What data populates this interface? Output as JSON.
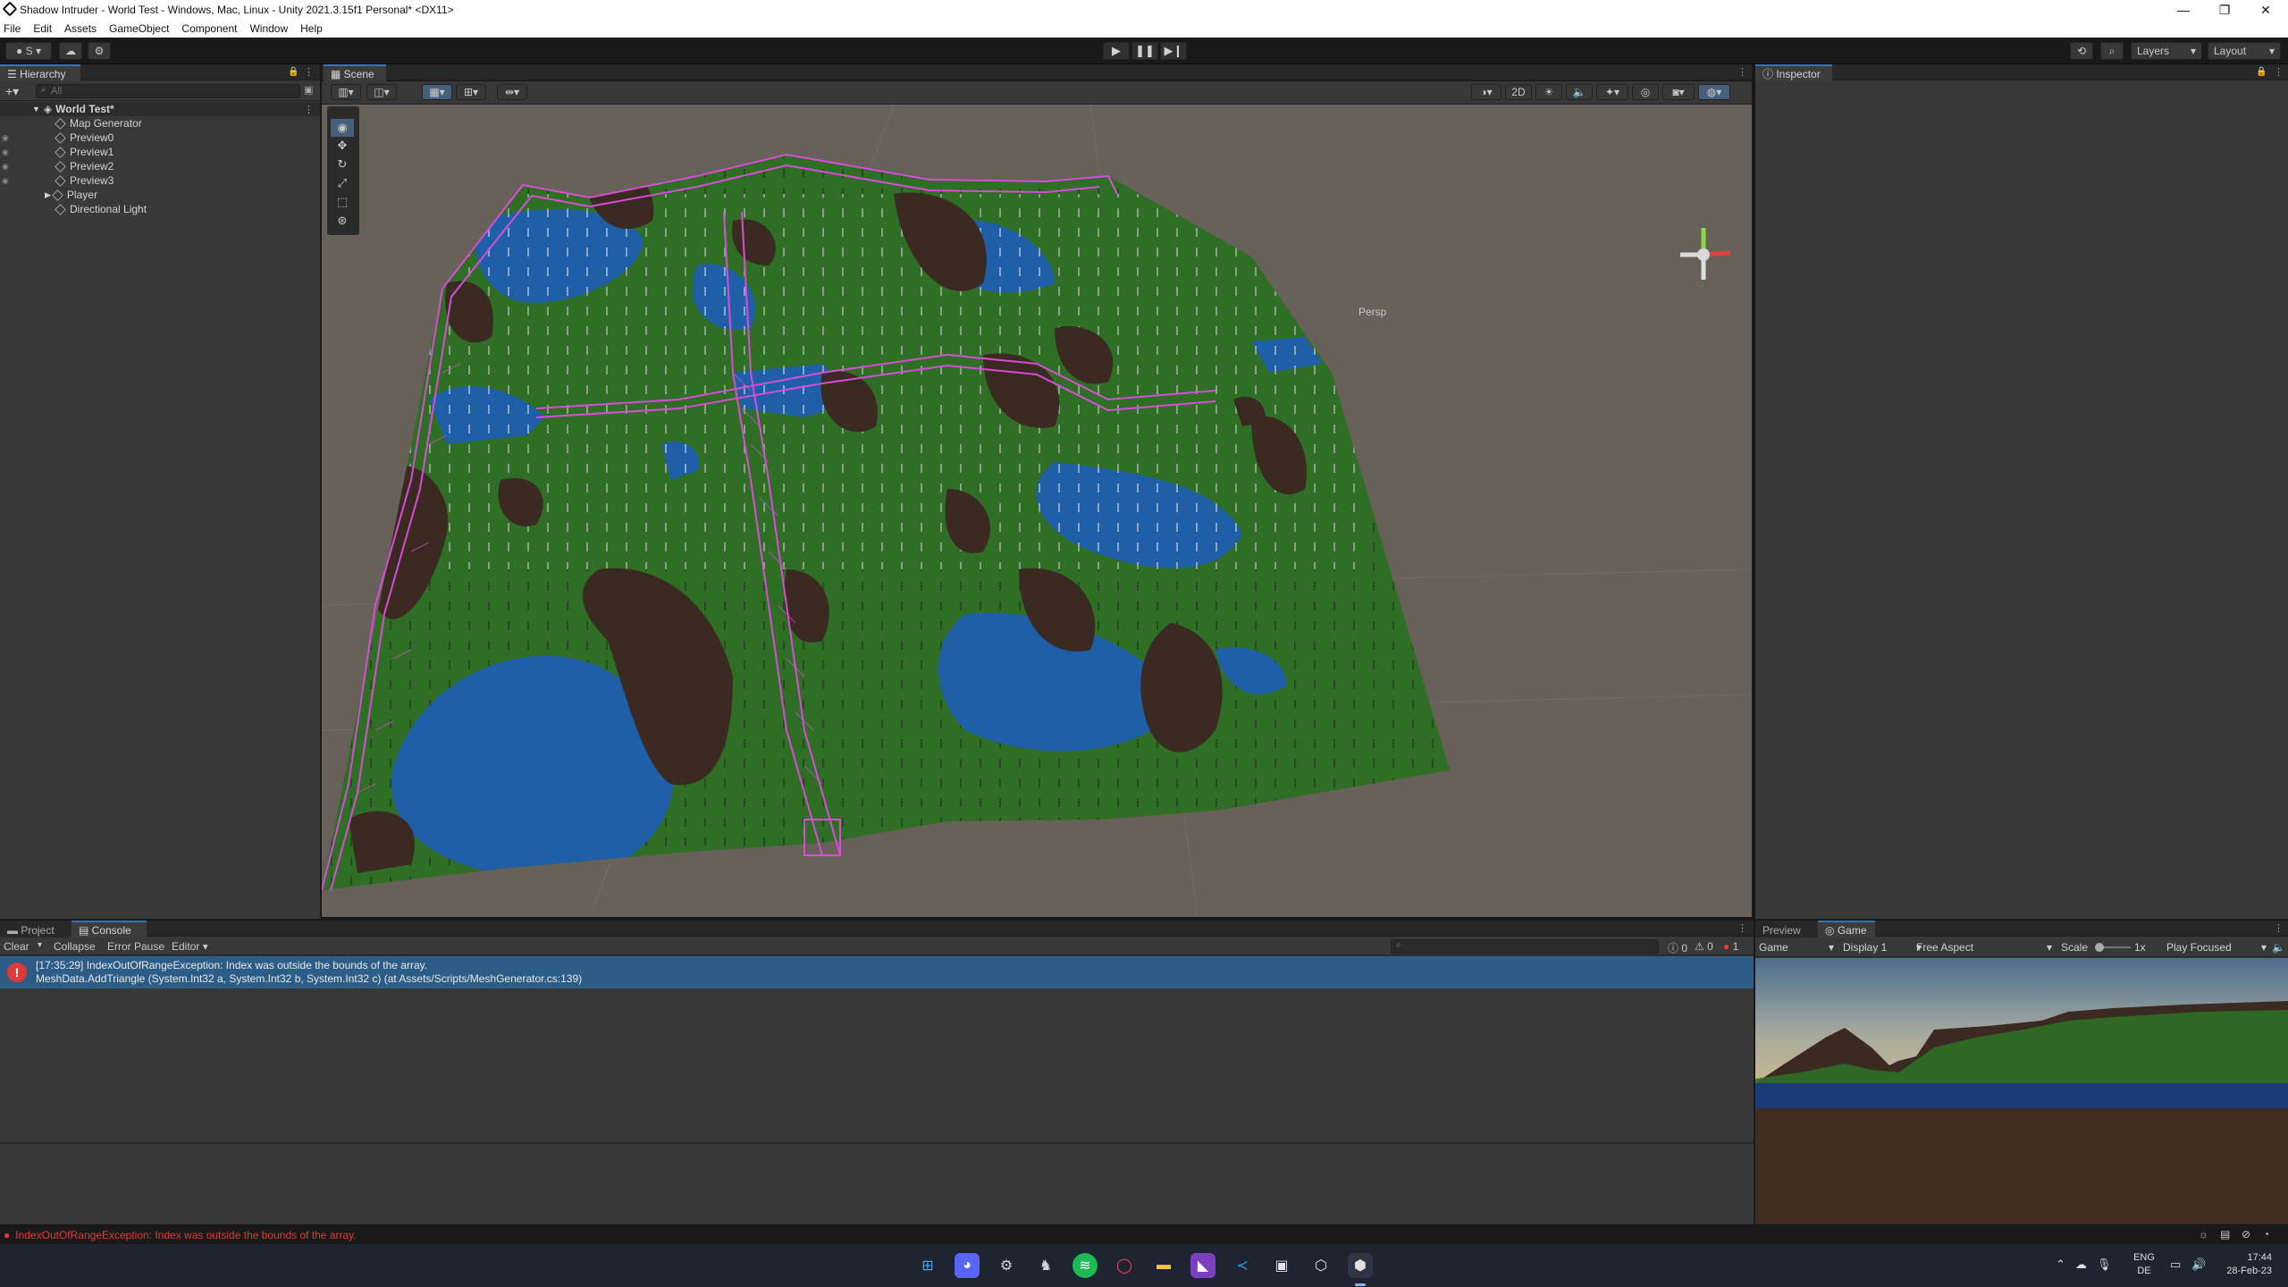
{
  "window": {
    "title": "Shadow Intruder - World Test - Windows, Mac, Linux - Unity 2021.3.15f1 Personal* <DX11>",
    "minimize": "—",
    "maximize": "❐",
    "close": "✕"
  },
  "menu": [
    "File",
    "Edit",
    "Assets",
    "GameObject",
    "Component",
    "Window",
    "Help"
  ],
  "toolbar": {
    "account": "S",
    "layers": "Layers",
    "layout": "Layout"
  },
  "hierarchy": {
    "tab": "Hierarchy",
    "search_placeholder": "All",
    "scene_name": "World Test*",
    "items": [
      "Map Generator",
      "Preview0",
      "Preview1",
      "Preview2",
      "Preview3",
      "Player",
      "Directional Light"
    ]
  },
  "scene": {
    "tab": "Scene",
    "mode_2d": "2D",
    "persp": "Persp"
  },
  "inspector": {
    "tab": "Inspector"
  },
  "bottom": {
    "tab_project": "Project",
    "tab_console": "Console",
    "clear": "Clear",
    "collapse": "Collapse",
    "error_pause": "Error Pause",
    "editor": "Editor",
    "count_info": "0",
    "count_warn": "0",
    "count_error": "1",
    "log_line1": "[17:35:29] IndexOutOfRangeException: Index was outside the bounds of the array.",
    "log_line2": "MeshData.AddTriangle (System.Int32 a, System.Int32 b, System.Int32 c) (at Assets/Scripts/MeshGenerator.cs:139)"
  },
  "game": {
    "tab_preview": "Preview",
    "tab_game": "Game",
    "mode": "Game",
    "display": "Display 1",
    "aspect": "Free Aspect",
    "scale_label": "Scale",
    "scale_value": "1x",
    "play_focused": "Play Focused"
  },
  "status": {
    "message": "IndexOutOfRangeException: Index was outside the bounds of the array."
  },
  "taskbar": {
    "lang": "ENG",
    "region": "DE",
    "time": "17:44",
    "date": "28-Feb-23"
  },
  "colors": {
    "grass": "#2f6e25",
    "water": "#1e5fa8",
    "rock": "#3b2a22",
    "gizmo": "#d84cd8",
    "error_red": "#e03b3b",
    "selection_blue": "#2c5d87"
  }
}
